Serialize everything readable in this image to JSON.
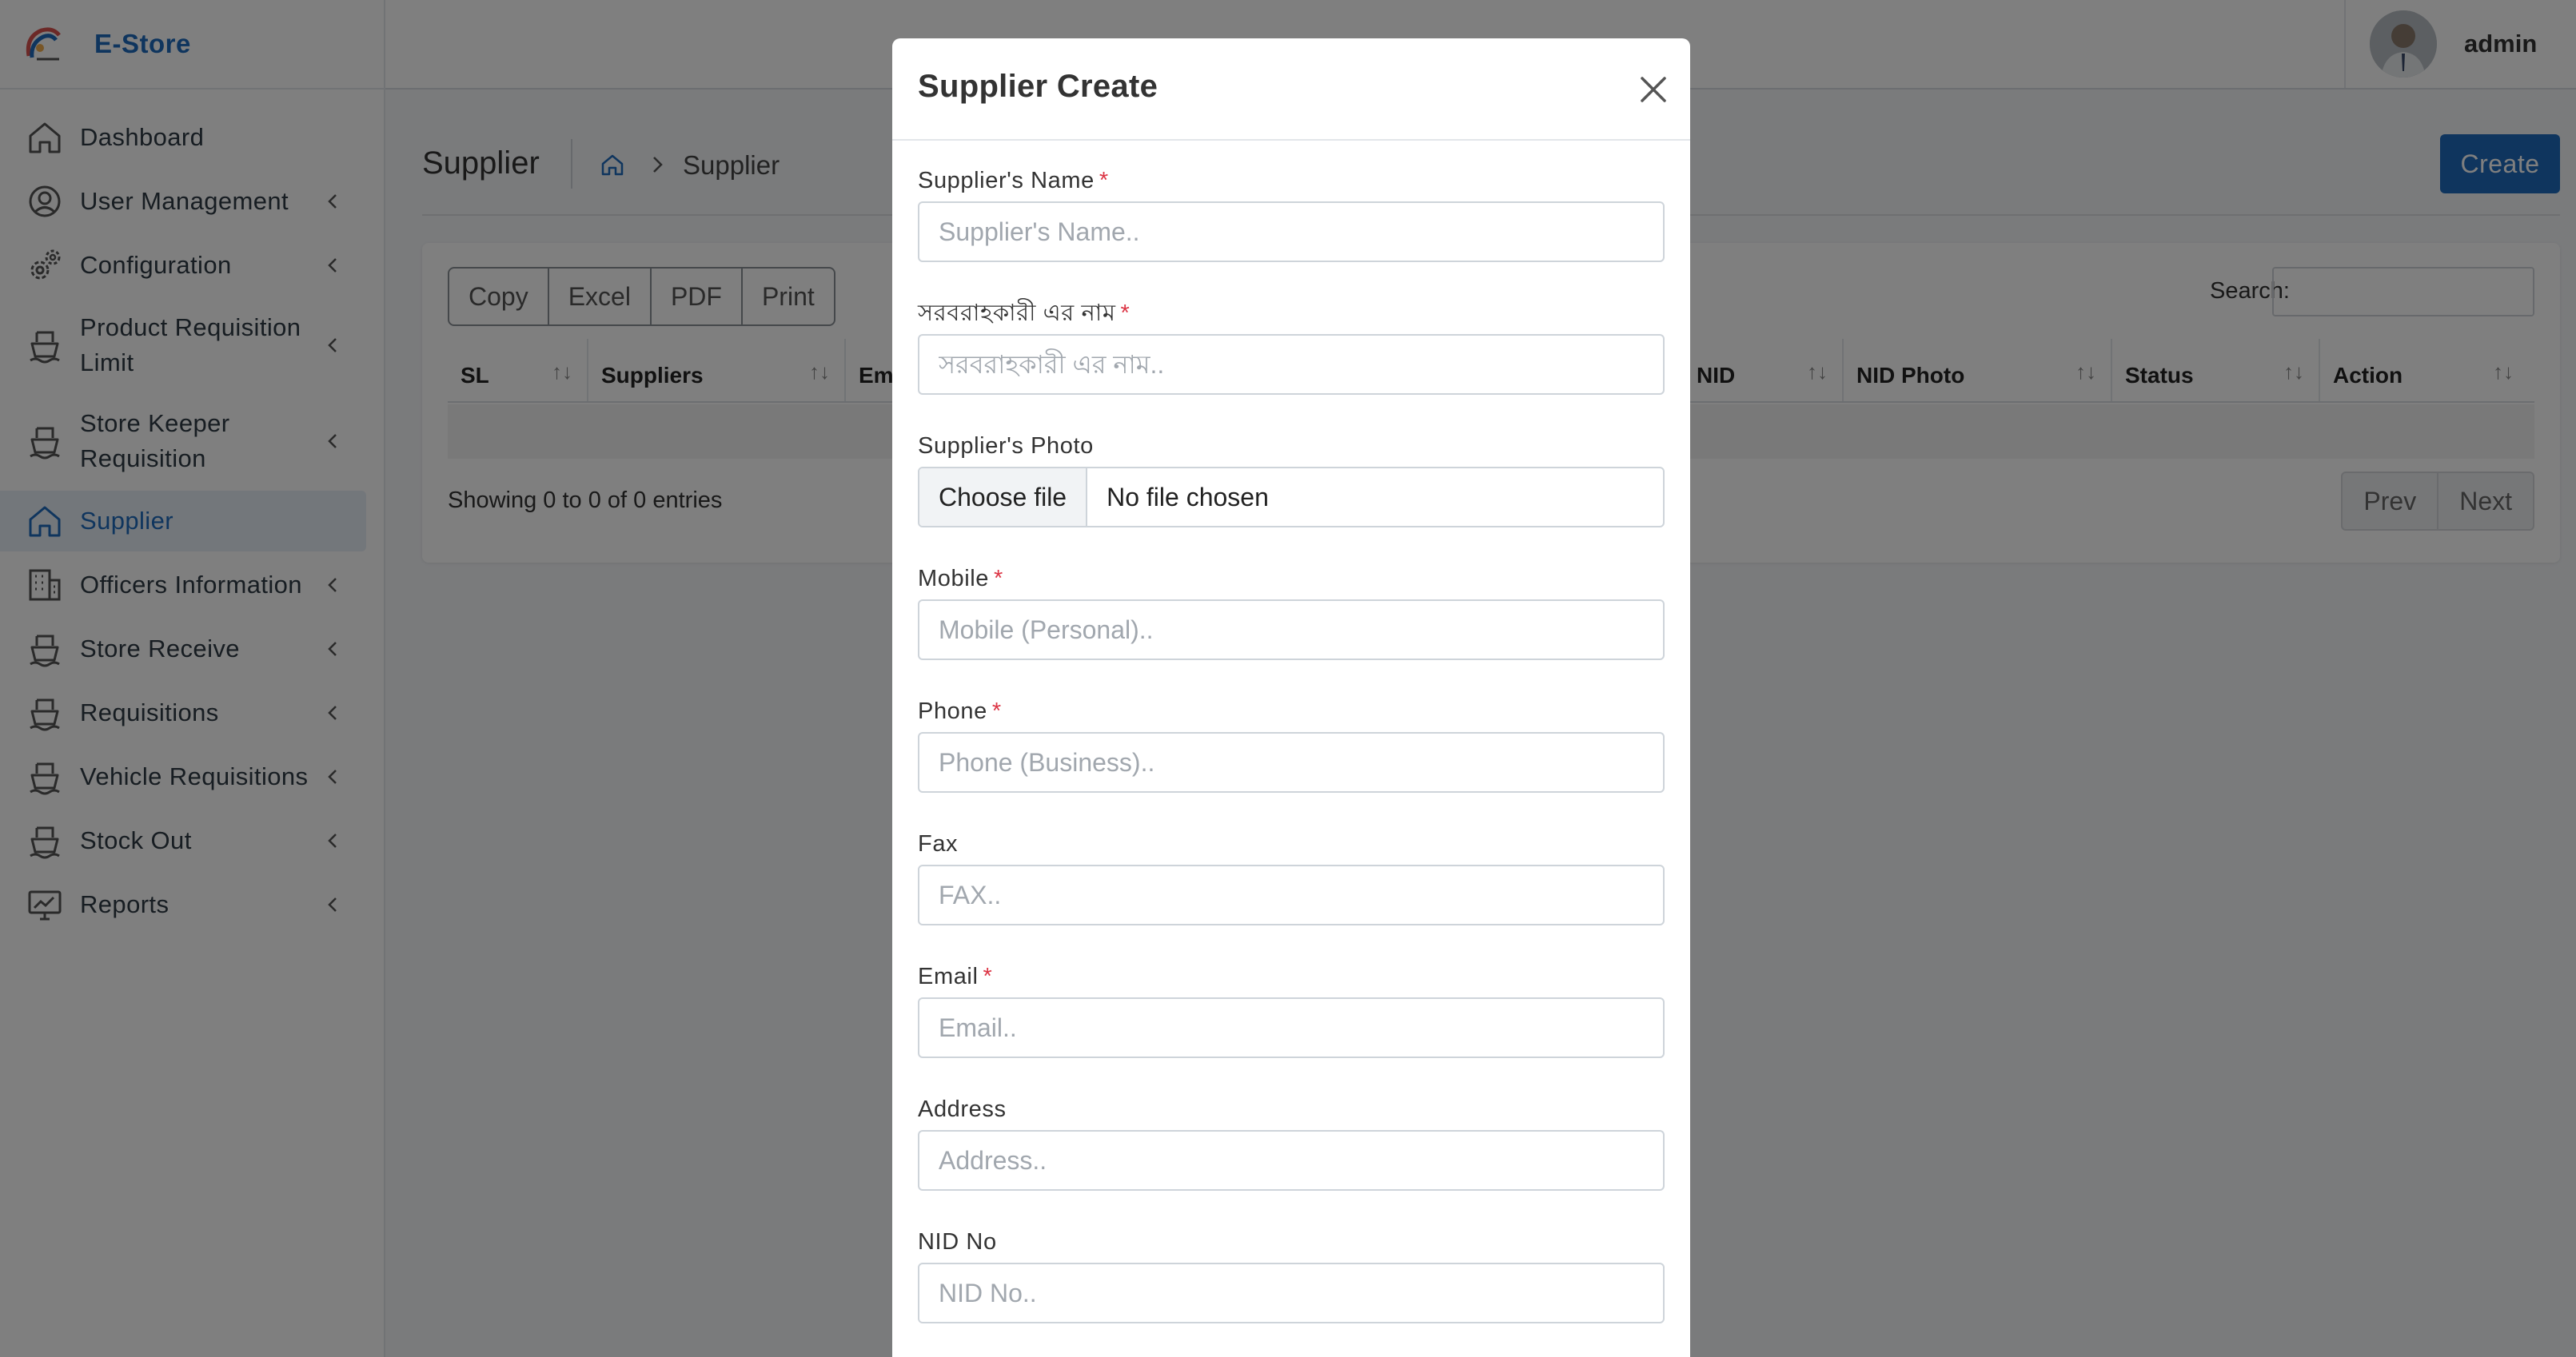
{
  "app": {
    "brand": "E-Store",
    "user_name": "admin"
  },
  "sidebar": {
    "items": [
      {
        "label": "Dashboard",
        "icon": "home-icon",
        "chevron": false,
        "active": false
      },
      {
        "label": "User Management",
        "icon": "user-circle-icon",
        "chevron": true,
        "active": false
      },
      {
        "label": "Configuration",
        "icon": "gears-icon",
        "chevron": true,
        "active": false
      },
      {
        "label": "Product Requisition Limit",
        "icon": "ship-icon",
        "chevron": true,
        "active": false
      },
      {
        "label": "Store Keeper Requisition",
        "icon": "ship-icon",
        "chevron": true,
        "active": false
      },
      {
        "label": "Supplier",
        "icon": "home-icon",
        "chevron": false,
        "active": true
      },
      {
        "label": "Officers Information",
        "icon": "building-icon",
        "chevron": true,
        "active": false
      },
      {
        "label": "Store Receive",
        "icon": "ship-icon",
        "chevron": true,
        "active": false
      },
      {
        "label": "Requisitions",
        "icon": "ship-icon",
        "chevron": true,
        "active": false
      },
      {
        "label": "Vehicle Requisitions",
        "icon": "ship-icon",
        "chevron": true,
        "active": false
      },
      {
        "label": "Stock Out",
        "icon": "ship-icon",
        "chevron": true,
        "active": false
      },
      {
        "label": "Reports",
        "icon": "monitor-chart-icon",
        "chevron": true,
        "active": false
      }
    ]
  },
  "page": {
    "title": "Supplier",
    "breadcrumb": "Supplier",
    "create_label": "Create",
    "export_buttons": [
      "Copy",
      "Excel",
      "PDF",
      "Print"
    ],
    "search_label": "Search:",
    "columns": [
      "SL",
      "Suppliers",
      "Em",
      "NID",
      "NID Photo",
      "Status",
      "Action"
    ],
    "entries_text": "Showing 0 to 0 of 0 entries",
    "prev_label": "Prev",
    "next_label": "Next"
  },
  "modal": {
    "title": "Supplier Create",
    "fields": {
      "name": {
        "label": "Supplier's Name",
        "placeholder": "Supplier's Name..",
        "required": "*"
      },
      "name_bn": {
        "label": "সরবরাহকারী এর নাম",
        "placeholder": "সরবরাহকারী এর নাম..",
        "required": "*"
      },
      "photo": {
        "label": "Supplier's Photo",
        "button": "Choose file",
        "status": "No file chosen"
      },
      "mobile": {
        "label": "Mobile",
        "placeholder": "Mobile (Personal)..",
        "required": "*"
      },
      "phone": {
        "label": "Phone",
        "placeholder": "Phone (Business)..",
        "required": "*"
      },
      "fax": {
        "label": "Fax",
        "placeholder": "FAX.."
      },
      "email": {
        "label": "Email",
        "placeholder": "Email..",
        "required": "*"
      },
      "address": {
        "label": "Address",
        "placeholder": "Address.."
      },
      "nid": {
        "label": "NID No",
        "placeholder": "NID No.."
      }
    }
  },
  "colors": {
    "primary": "#1e6bbd",
    "required": "#dc3545",
    "backdrop": "rgba(0,0,0,0.5)"
  }
}
